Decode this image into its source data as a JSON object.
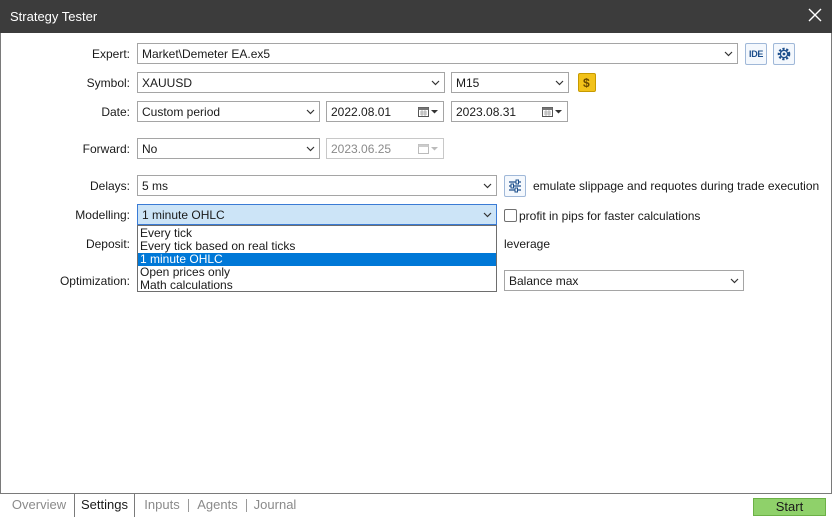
{
  "window": {
    "title": "Strategy Tester"
  },
  "expert": {
    "label": "Expert:",
    "value": "Market\\Demeter EA.ex5",
    "ide_label": "IDE"
  },
  "symbol": {
    "label": "Symbol:",
    "value": "XAUUSD",
    "timeframe": "M15"
  },
  "date": {
    "label": "Date:",
    "period": "Custom period",
    "from": "2022.08.01",
    "to": "2023.08.31"
  },
  "forward": {
    "label": "Forward:",
    "value": "No",
    "date": "2023.06.25"
  },
  "delays": {
    "label": "Delays:",
    "value": "5 ms",
    "note": "emulate slippage and requotes during trade execution"
  },
  "modelling": {
    "label": "Modelling:",
    "value": "1 minute OHLC",
    "pips_option": "profit in pips for faster calculations",
    "options": [
      "Every tick",
      "Every tick based on real ticks",
      "1 minute OHLC",
      "Open prices only",
      "Math calculations"
    ],
    "selected_index": 2
  },
  "deposit": {
    "label": "Deposit:",
    "leverage_label": "leverage"
  },
  "optimization": {
    "label": "Optimization:",
    "criterion": "Balance max"
  },
  "tabs": [
    "Overview",
    "Settings",
    "Inputs",
    "Agents",
    "Journal"
  ],
  "active_tab": "Settings",
  "start_button": "Start",
  "colors": {
    "titlebar": "#3c3c3c",
    "selection": "#0078d7",
    "start": "#8fd16a",
    "focused_field": "#cce4f7"
  }
}
